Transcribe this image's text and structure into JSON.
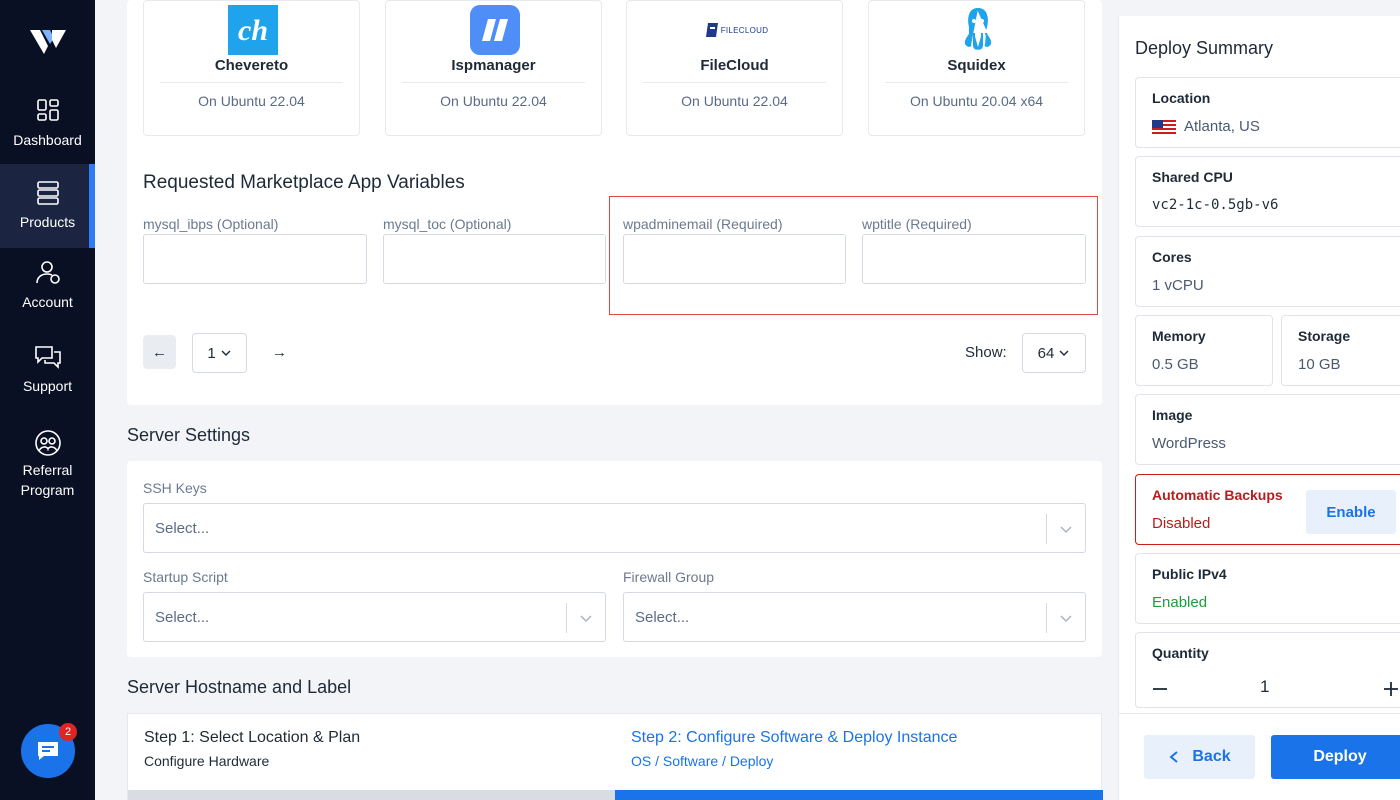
{
  "sidebar": {
    "items": [
      {
        "label": "Dashboard"
      },
      {
        "label": "Products"
      },
      {
        "label": "Account"
      },
      {
        "label": "Support"
      },
      {
        "label": "Referral Program"
      }
    ],
    "chat_badge": "2"
  },
  "apps": [
    {
      "name": "Chevereto",
      "sub": "On Ubuntu 22.04",
      "icon": "chevereto-icon"
    },
    {
      "name": "Ispmanager",
      "sub": "On Ubuntu 22.04",
      "icon": "ispmanager-icon"
    },
    {
      "name": "FileCloud",
      "sub": "On Ubuntu 22.04",
      "icon": "filecloud-icon",
      "logo_text": "FILECLOUD"
    },
    {
      "name": "Squidex",
      "sub": "On Ubuntu 20.04 x64",
      "icon": "squidex-icon"
    }
  ],
  "app_variables": {
    "title": "Requested Marketplace App Variables",
    "fields": [
      {
        "label": "mysql_ibps (Optional)",
        "value": ""
      },
      {
        "label": "mysql_toc (Optional)",
        "value": ""
      },
      {
        "label": "wpadminemail (Required)",
        "value": ""
      },
      {
        "label": "wptitle (Required)",
        "value": ""
      }
    ]
  },
  "pagination": {
    "prev": "←",
    "page": "1",
    "next": "→",
    "show_label": "Show:",
    "show_value": "64"
  },
  "server_settings": {
    "title": "Server Settings",
    "ssh_label": "SSH Keys",
    "ssh_placeholder": "Select...",
    "startup_label": "Startup Script",
    "startup_placeholder": "Select...",
    "firewall_label": "Firewall Group",
    "firewall_placeholder": "Select..."
  },
  "hostname": {
    "title": "Server Hostname and Label"
  },
  "steps": [
    {
      "title": "Step 1: Select Location & Plan",
      "sub": "Configure Hardware"
    },
    {
      "title": "Step 2: Configure Software & Deploy Instance",
      "sub": "OS / Software / Deploy"
    }
  ],
  "summary": {
    "title": "Deploy Summary",
    "location_label": "Location",
    "location_value": "Atlanta, US",
    "cpu_label": "Shared CPU",
    "cpu_value": "vc2-1c-0.5gb-v6",
    "cores_label": "Cores",
    "cores_value": "1 vCPU",
    "memory_label": "Memory",
    "memory_value": "0.5 GB",
    "storage_label": "Storage",
    "storage_value": "10 GB",
    "image_label": "Image",
    "image_value": "WordPress",
    "backups_label": "Automatic Backups",
    "backups_value": "Disabled",
    "backups_button": "Enable",
    "ipv4_label": "Public IPv4",
    "ipv4_value": "Enabled",
    "quantity_label": "Quantity",
    "quantity_value": "1",
    "back_button": "Back",
    "deploy_button": "Deploy"
  },
  "colors": {
    "accent": "#1a73e8",
    "sidebar": "#0a1024",
    "error": "#c81e1e",
    "success": "#1f9d3a"
  }
}
